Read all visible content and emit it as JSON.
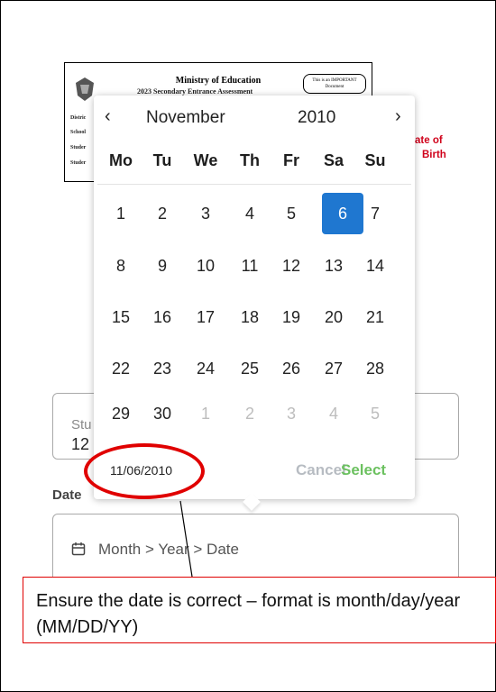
{
  "document": {
    "title": "Ministry of Education",
    "subtitle": "2023 Secondary Entrance Assessment",
    "badge": "This is an IMPORTANT Document",
    "fields": [
      "Distric",
      "School",
      "Studer",
      "Studer"
    ],
    "side_text_line1": "ate of",
    "side_text_line2": "Birth"
  },
  "form": {
    "student_label": "Stu",
    "student_value": "12",
    "date_label": "Date",
    "date_placeholder": "Month > Year > Date"
  },
  "picker": {
    "month": "November",
    "year": "2010",
    "prev_icon": "‹",
    "next_icon": "›",
    "weekdays": [
      "Mo",
      "Tu",
      "We",
      "Th",
      "Fr",
      "Sa",
      "Su"
    ],
    "weeks": [
      [
        "1",
        "2",
        "3",
        "4",
        "5",
        "6",
        "7"
      ],
      [
        "8",
        "9",
        "10",
        "11",
        "12",
        "13",
        "14"
      ],
      [
        "15",
        "16",
        "17",
        "18",
        "19",
        "20",
        "21"
      ],
      [
        "22",
        "23",
        "24",
        "25",
        "26",
        "27",
        "28"
      ],
      [
        "29",
        "30",
        "1",
        "2",
        "3",
        "4",
        "5"
      ]
    ],
    "selected_day": "6",
    "selected_date": "11/06/2010",
    "cancel_label": "Cancel",
    "select_label": "Select"
  },
  "annotation": {
    "text": "Ensure the date is correct – format is month/day/year (MM/DD/YY)",
    "color": "#e00000"
  },
  "colors": {
    "selected_bg": "#1f77d0",
    "select_button": "#6cc160",
    "cancel_button": "#b7bcc2"
  }
}
